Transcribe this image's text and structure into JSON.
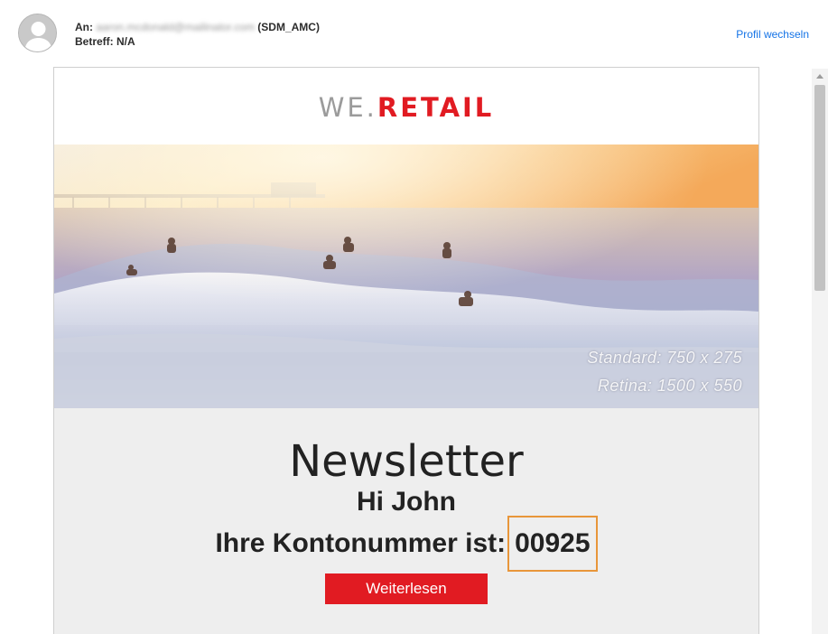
{
  "header": {
    "to_label": "An:",
    "to_email": "aaron.mcdonald@mailinator.com",
    "to_org": "(SDM_AMC)",
    "subject_label": "Betreff:",
    "subject_value": "N/A",
    "switch_profile": "Profil wechseln"
  },
  "email": {
    "brand_prefix": "WE.",
    "brand_suffix": "RETAIL",
    "hero_label_standard": "Standard: 750 x 275",
    "hero_label_retina": "Retina: 1500 x 550",
    "title": "Newsletter",
    "greeting": "Hi John",
    "account_label": "Ihre Kontonummer ist:",
    "account_number": "00925",
    "cta_label": "Weiterlesen"
  },
  "colors": {
    "brand_red": "#e11b22",
    "highlight_orange": "#e8963a",
    "link_blue": "#1473e6"
  }
}
